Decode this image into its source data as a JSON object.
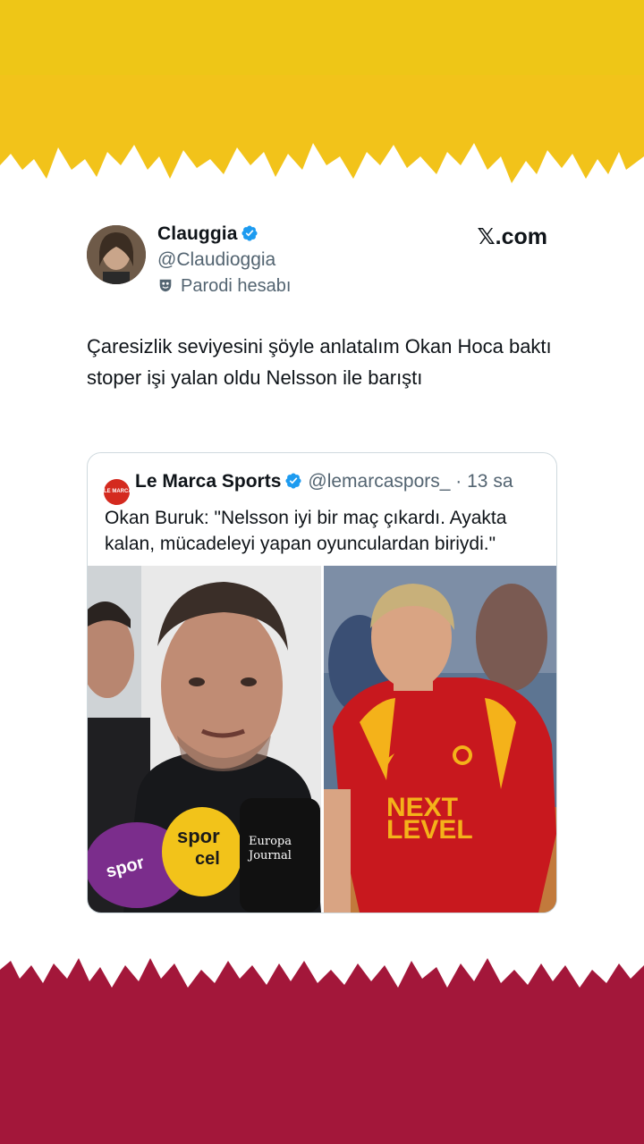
{
  "theme": {
    "top_band_color": "#f2c31a",
    "bottom_band_color": "#a3173a",
    "verified_color": "#1d9bf0"
  },
  "tweet": {
    "author_name": "Clauggia",
    "author_handle": "@Claudioggia",
    "parody_label": "Parodi hesabı",
    "brand_x": "𝕏",
    "brand_domain": ".com",
    "text": "Çaresizlik seviyesini şöyle anlatalım Okan Hoca baktı stoper işi yalan oldu Nelsson ile barıştı",
    "avatar_icon": "user-avatar",
    "verified_icon": "verified-badge-icon",
    "parody_icon": "parody-mask-icon"
  },
  "quoted_tweet": {
    "logo_text": "LE MARCA",
    "author_name": "Le Marca Sports",
    "author_handle": "@lemarcaspors_",
    "separator": "·",
    "time": "13 sa",
    "text": "Okan Buruk: \"Nelsson iyi bir maç çıkardı. Ayakta kalan, mücadeleyi yapan oyunculardan biriydi.\"",
    "media": {
      "left_mic_labels": [
        "spor",
        "spor",
        "cel",
        "Europa",
        "Journal"
      ],
      "right_jersey_text_1": "NEXT",
      "right_jersey_text_2": "LEVEL"
    }
  }
}
